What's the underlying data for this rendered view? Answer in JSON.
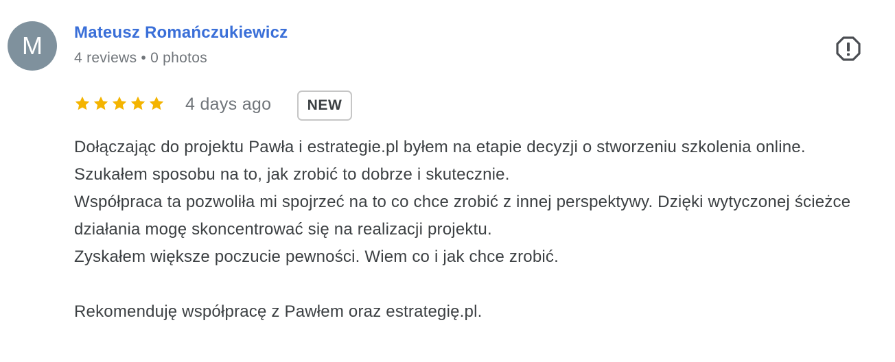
{
  "author": {
    "initial": "M",
    "name": "Mateusz Romańczukiewicz",
    "reviews": "4 reviews",
    "separator": "•",
    "photos": "0 photos"
  },
  "rating": {
    "stars": 5,
    "max": 5,
    "star_color": "#f4b400"
  },
  "time_ago": "4 days ago",
  "badge": "NEW",
  "icons": {
    "report": "report-flag-icon",
    "star": "star-icon"
  },
  "review": {
    "paragraph1": [
      "Dołączając do projektu Pawła i estrategie.pl byłem na etapie decyzji o stworzeniu szkolenia online.",
      "Szukałem sposobu na to, jak zrobić to dobrze i skutecznie.",
      "Współpraca ta pozwoliła mi spojrzeć na to co chce zrobić z innej perspektywy. Dzięki wytyczonej ścieżce działania mogę skoncentrować się na realizacji projektu.",
      "Zyskałem większe poczucie pewności. Wiem co i jak chce zrobić."
    ],
    "paragraph2": "Rekomenduję współpracę z Pawłem oraz estrategię.pl."
  }
}
